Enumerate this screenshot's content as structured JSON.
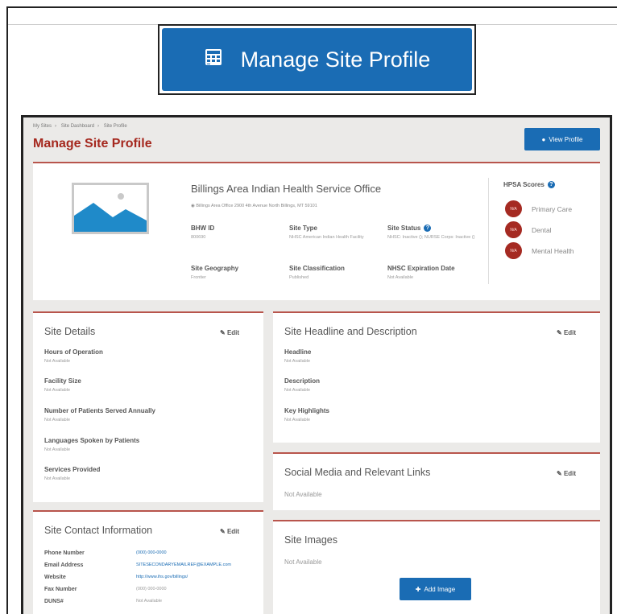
{
  "hero": {
    "icon": "calculator-grid-icon",
    "label": "Manage Site Profile",
    "color": "#1a6cb4"
  },
  "breadcrumb": [
    "My Sites",
    "Site Dashboard",
    "Site Profile"
  ],
  "page": {
    "title": "Manage Site Profile",
    "view_profile_label": "View Profile",
    "accent": "#a5281e"
  },
  "summary": {
    "site_name": "Billings Area Indian Health Service Office",
    "address": "Billings Area Office 2900 4th Avenue North Billings, MT 59101",
    "fields": [
      {
        "label": "BHW ID",
        "value": "800690"
      },
      {
        "label": "Site Type",
        "value": "NHSC American Indian Health Facility"
      },
      {
        "label": "Site Status",
        "value": "NHSC: Inactive (); NURSE Corps: Inactive ()"
      },
      {
        "label": "Site Geography",
        "value": "Frontier"
      },
      {
        "label": "Site Classification",
        "value": "Published"
      },
      {
        "label": "NHSC Expiration Date",
        "value": "Not Available"
      }
    ],
    "hpsa_title": "HPSA Scores",
    "hpsa": [
      {
        "score": "N/A",
        "label": "Primary Care"
      },
      {
        "score": "N/A",
        "label": "Dental"
      },
      {
        "score": "N/A",
        "label": "Mental Health"
      }
    ]
  },
  "site_details": {
    "title": "Site Details",
    "edit_label": "Edit",
    "fields": [
      {
        "label": "Hours of Operation",
        "value": "Not Available"
      },
      {
        "label": "Facility Size",
        "value": "Not Available"
      },
      {
        "label": "Number of Patients Served Annually",
        "value": "Not Available"
      },
      {
        "label": "Languages Spoken by Patients",
        "value": "Not Available"
      },
      {
        "label": "Services Provided",
        "value": "Not Available"
      }
    ]
  },
  "headline": {
    "title": "Site Headline and Description",
    "edit_label": "Edit",
    "fields": [
      {
        "label": "Headline",
        "value": "Not Available"
      },
      {
        "label": "Description",
        "value": "Not Available"
      },
      {
        "label": "Key Highlights",
        "value": "Not Available"
      }
    ]
  },
  "social": {
    "title": "Social Media and Relevant Links",
    "edit_label": "Edit",
    "value": "Not Available"
  },
  "contact": {
    "title": "Site Contact Information",
    "edit_label": "Edit",
    "rows": [
      {
        "label": "Phone Number",
        "value": "(000) 000-0000"
      },
      {
        "label": "Email Address",
        "value": "SITESECONDARYEMAILREF@EXAMPLE.com"
      },
      {
        "label": "Website",
        "value": "http://www.ihs.gov/billings/"
      },
      {
        "label": "Fax Number",
        "value": "(000) 000-0000"
      },
      {
        "label": "DUNS#",
        "value": "Not Available"
      }
    ]
  },
  "images": {
    "title": "Site Images",
    "value": "Not Available",
    "add_label": "Add Image"
  }
}
